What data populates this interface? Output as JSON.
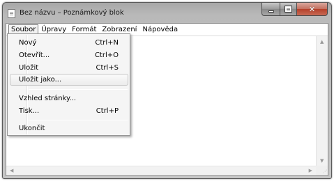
{
  "window": {
    "title": "Bez názvu – Poznámkový blok",
    "caption_close_glyph": "✕"
  },
  "menubar": {
    "items": [
      {
        "label": "Soubor"
      },
      {
        "label": "Úpravy"
      },
      {
        "label": "Formát"
      },
      {
        "label": "Zobrazení"
      },
      {
        "label": "Nápověda"
      }
    ],
    "active": "Soubor"
  },
  "file_menu": {
    "items": [
      {
        "label": "Nový",
        "shortcut": "Ctrl+N"
      },
      {
        "label": "Otevřít...",
        "shortcut": "Ctrl+O"
      },
      {
        "label": "Uložit",
        "shortcut": "Ctrl+S"
      },
      {
        "label": "Uložit jako...",
        "shortcut": ""
      },
      {
        "label": "Vzhled stránky...",
        "shortcut": ""
      },
      {
        "label": "Tisk...",
        "shortcut": "Ctrl+P"
      },
      {
        "label": "Ukončit",
        "shortcut": ""
      }
    ],
    "highlighted": "Uložit jako..."
  },
  "editor": {
    "content": ""
  },
  "icons": {
    "app": "notepad-icon",
    "minimize": "minimize-icon",
    "maximize": "maximize-icon",
    "close": "close-icon"
  },
  "colors": {
    "close_button": "#c46f5e",
    "frame": "#b9b9b9"
  }
}
